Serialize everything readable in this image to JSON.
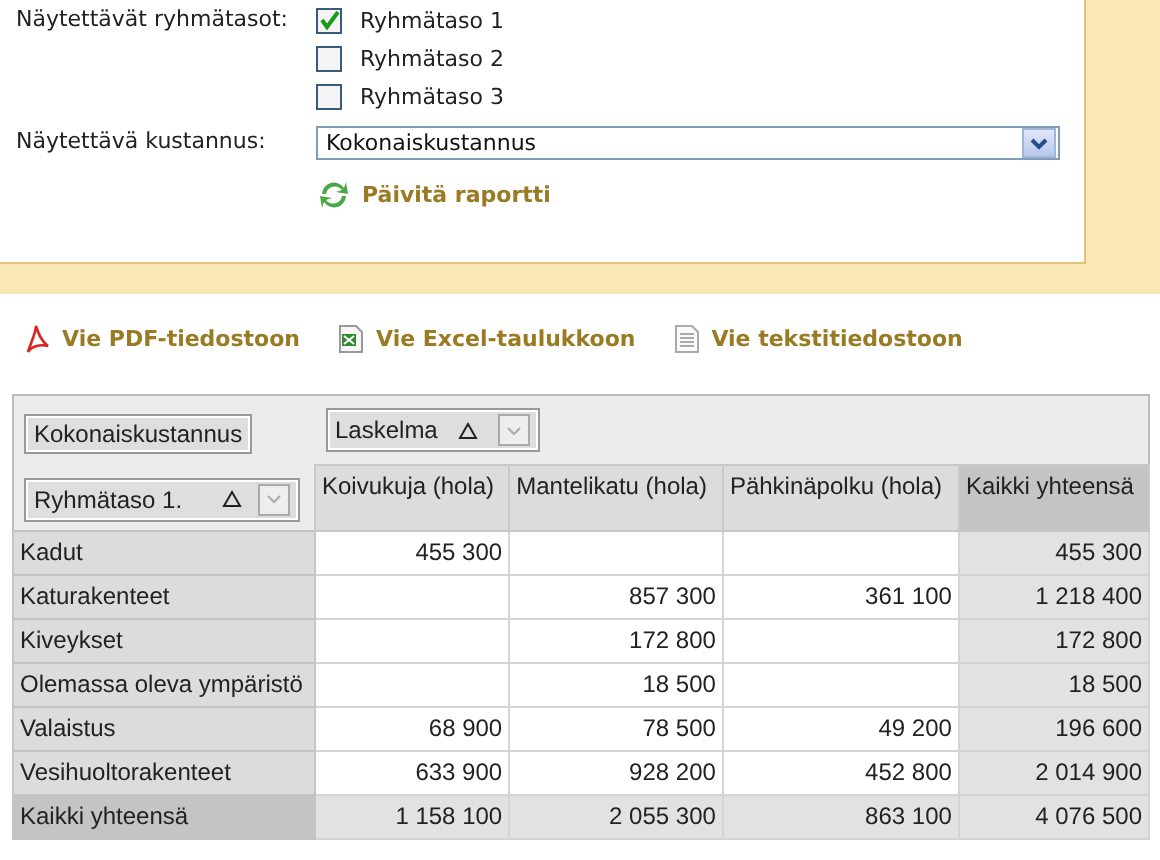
{
  "form": {
    "group_label": "Näytettävät ryhmätasot:",
    "group_levels": [
      {
        "label": "Ryhmätaso 1",
        "checked": true
      },
      {
        "label": "Ryhmätaso 2",
        "checked": false
      },
      {
        "label": "Ryhmätaso 3",
        "checked": false
      }
    ],
    "cost_label": "Näytettävä kustannus:",
    "cost_value": "Kokonaiskustannus",
    "refresh": "Päivitä raportti"
  },
  "exports": [
    {
      "kind": "pdf",
      "label": "Vie PDF-tiedostoon"
    },
    {
      "kind": "excel",
      "label": "Vie Excel-taulukkoon"
    },
    {
      "kind": "text",
      "label": "Vie tekstitiedostoon"
    }
  ],
  "pivot": {
    "filter_field": "Kokonaiskustannus",
    "column_field": "Laskelma",
    "row_field": "Ryhmätaso 1.",
    "columns": [
      "Koivukuja (hola)",
      "Mantelikatu (hola)",
      "Pähkinäpolku (hola)",
      "Kaikki yhteensä"
    ],
    "rows": [
      {
        "label": "Kadut",
        "cells": [
          "455 300",
          "",
          "",
          "455 300"
        ]
      },
      {
        "label": "Katurakenteet",
        "cells": [
          "",
          "857 300",
          "361 100",
          "1 218 400"
        ]
      },
      {
        "label": "Kiveykset",
        "cells": [
          "",
          "172 800",
          "",
          "172 800"
        ]
      },
      {
        "label": "Olemassa oleva ympäristö",
        "cells": [
          "",
          "18 500",
          "",
          "18 500"
        ]
      },
      {
        "label": "Valaistus",
        "cells": [
          "68 900",
          "78 500",
          "49 200",
          "196 600"
        ]
      },
      {
        "label": "Vesihuoltorakenteet",
        "cells": [
          "633 900",
          "928 200",
          "452 800",
          "2 014 900"
        ]
      }
    ],
    "total": {
      "label": "Kaikki yhteensä",
      "cells": [
        "1 158 100",
        "2 055 300",
        "863 100",
        "4 076 500"
      ]
    }
  }
}
